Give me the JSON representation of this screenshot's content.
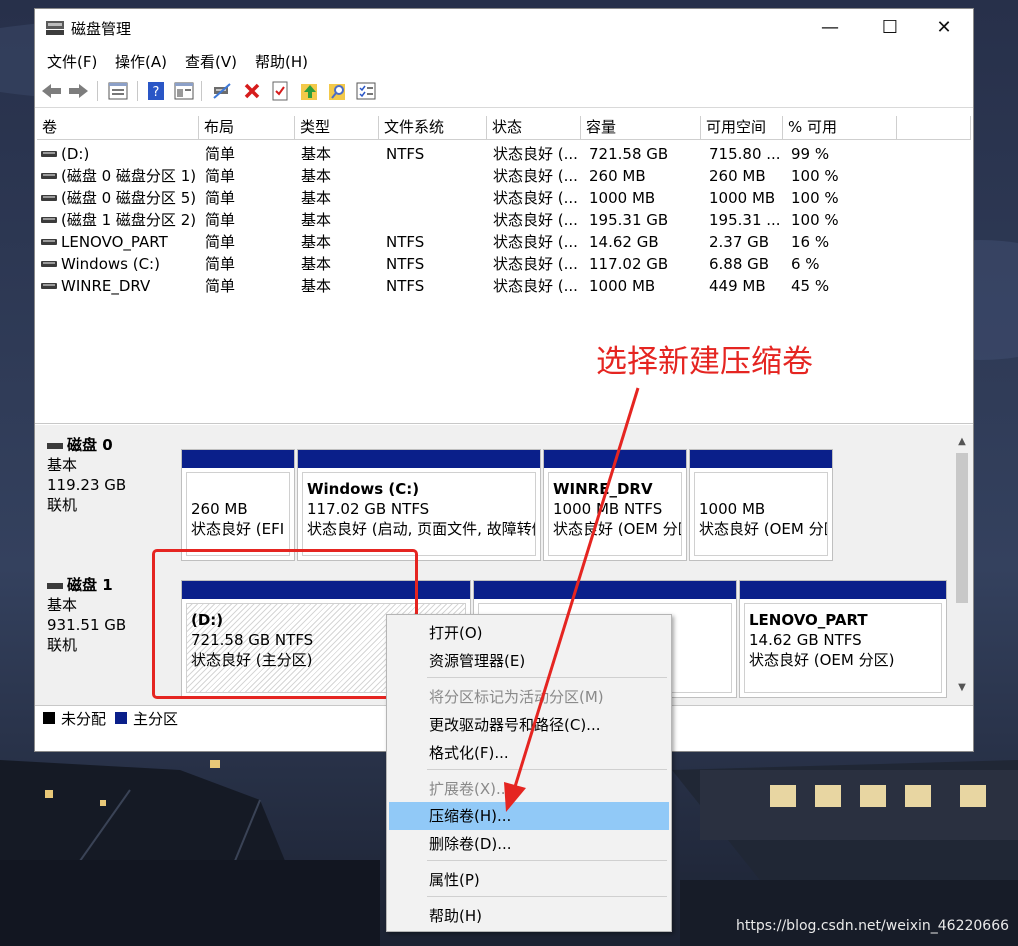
{
  "window": {
    "title": "磁盘管理",
    "controls": {
      "minimize": "—",
      "maximize": "☐",
      "close": "✕"
    }
  },
  "menubar": [
    "文件(F)",
    "操作(A)",
    "查看(V)",
    "帮助(H)"
  ],
  "toolbar": {
    "icons": [
      "back-icon",
      "forward-icon",
      "list-view-icon",
      "help-icon",
      "properties-icon",
      "connect-icon",
      "delete-icon",
      "check-icon",
      "up-icon",
      "search-icon",
      "details-icon"
    ]
  },
  "volume_list": {
    "headers": [
      "卷",
      "布局",
      "类型",
      "文件系统",
      "状态",
      "容量",
      "可用空间",
      "% 可用"
    ],
    "rows": [
      [
        "(D:)",
        "简单",
        "基本",
        "NTFS",
        "状态良好 (...",
        "721.58 GB",
        "715.80 ...",
        "99 %"
      ],
      [
        "(磁盘 0 磁盘分区 1)",
        "简单",
        "基本",
        "",
        "状态良好 (...",
        "260 MB",
        "260 MB",
        "100 %"
      ],
      [
        "(磁盘 0 磁盘分区 5)",
        "简单",
        "基本",
        "",
        "状态良好 (...",
        "1000 MB",
        "1000 MB",
        "100 %"
      ],
      [
        "(磁盘 1 磁盘分区 2)",
        "简单",
        "基本",
        "",
        "状态良好 (...",
        "195.31 GB",
        "195.31 ...",
        "100 %"
      ],
      [
        "LENOVO_PART",
        "简单",
        "基本",
        "NTFS",
        "状态良好 (...",
        "14.62 GB",
        "2.37 GB",
        "16 %"
      ],
      [
        "Windows (C:)",
        "简单",
        "基本",
        "NTFS",
        "状态良好 (...",
        "117.02 GB",
        "6.88 GB",
        "6 %"
      ],
      [
        "WINRE_DRV",
        "简单",
        "基本",
        "NTFS",
        "状态良好 (...",
        "1000 MB",
        "449 MB",
        "45 %"
      ]
    ]
  },
  "disks": [
    {
      "name": "磁盘 0",
      "type": "基本",
      "size": "119.23 GB",
      "status": "联机",
      "partitions": [
        {
          "name": "",
          "size": "260 MB",
          "status": "状态良好 (EFI 系"
        },
        {
          "name": "Windows  (C:)",
          "size": "117.02 GB NTFS",
          "status": "状态良好 (启动, 页面文件, 故障转储"
        },
        {
          "name": "WINRE_DRV",
          "size": "1000 MB NTFS",
          "status": "状态良好 (OEM 分区"
        },
        {
          "name": "",
          "size": "1000 MB",
          "status": "状态良好 (OEM 分区"
        }
      ]
    },
    {
      "name": "磁盘 1",
      "type": "基本",
      "size": "931.51 GB",
      "status": "联机",
      "partitions": [
        {
          "name": "(D:)",
          "size": "721.58 GB NTFS",
          "status": "状态良好 (主分区)"
        },
        {
          "name": "",
          "size": "",
          "status": ""
        },
        {
          "name": "LENOVO_PART",
          "size": "14.62 GB NTFS",
          "status": "状态良好 (OEM 分区)"
        }
      ]
    }
  ],
  "legend": [
    {
      "label": "未分配",
      "color": "#000000"
    },
    {
      "label": "主分区",
      "color": "#0a1f8a"
    }
  ],
  "context_menu": {
    "items": [
      {
        "label": "打开(O)",
        "disabled": false
      },
      {
        "label": "资源管理器(E)",
        "disabled": false
      },
      {
        "label": "将分区标记为活动分区(M)",
        "disabled": true
      },
      {
        "label": "更改驱动器号和路径(C)...",
        "disabled": false
      },
      {
        "label": "格式化(F)...",
        "disabled": false
      },
      {
        "label": "扩展卷(X)...",
        "disabled": true
      },
      {
        "label": "压缩卷(H)...",
        "disabled": false,
        "highlighted": true
      },
      {
        "label": "删除卷(D)...",
        "disabled": false
      },
      {
        "label": "属性(P)",
        "disabled": false
      },
      {
        "label": "帮助(H)",
        "disabled": false
      }
    ]
  },
  "annotation": {
    "text": "选择新建压缩卷",
    "color": "#e52521"
  },
  "watermark": "https://blog.csdn.net/weixin_46220666"
}
